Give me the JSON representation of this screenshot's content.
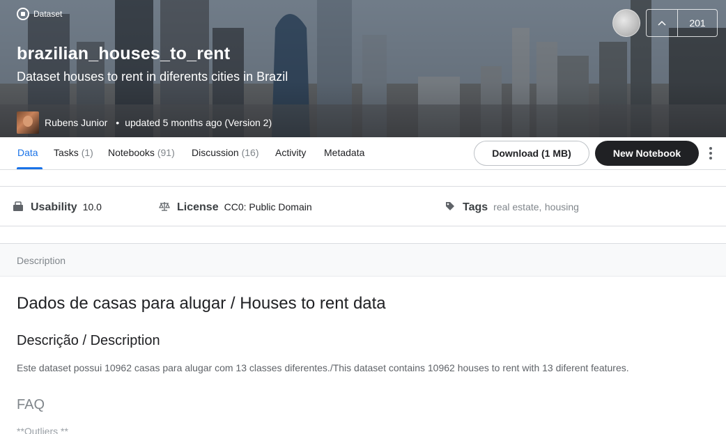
{
  "header": {
    "type_label": "Dataset",
    "title": "brazilian_houses_to_rent",
    "subtitle": "Dataset houses to rent in diferents cities in Brazil",
    "owner": "Rubens Junior",
    "updated": "updated 5 months ago (Version 2)",
    "votes": "201",
    "upvote_icon": "chevron-up-icon"
  },
  "tabs": [
    {
      "label": "Data",
      "count": ""
    },
    {
      "label": "Tasks",
      "count": "(1)"
    },
    {
      "label": "Notebooks",
      "count": "(91)"
    },
    {
      "label": "Discussion",
      "count": "(16)"
    },
    {
      "label": "Activity",
      "count": ""
    },
    {
      "label": "Metadata",
      "count": ""
    }
  ],
  "actions": {
    "download": "Download (1 MB)",
    "new_notebook": "New Notebook"
  },
  "meta": {
    "usability_label": "Usability",
    "usability_value": "10.0",
    "license_label": "License",
    "license_value": "CC0: Public Domain",
    "tags_label": "Tags",
    "tags": [
      "real estate",
      "housing"
    ],
    "tag_separator": ","
  },
  "description": {
    "section_label": "Description",
    "heading": "Dados de casas para alugar / Houses to rent data",
    "subheading": "Descrição / Description",
    "paragraph": "Este dataset possui 10962 casas para alugar com 13 classes diferentes./This dataset contains 10962 houses to rent with 13 diferent features.",
    "faq": "FAQ",
    "outliers": "**Outliers **"
  },
  "colors": {
    "accent": "#1a73e8",
    "primary_button": "#202124"
  }
}
